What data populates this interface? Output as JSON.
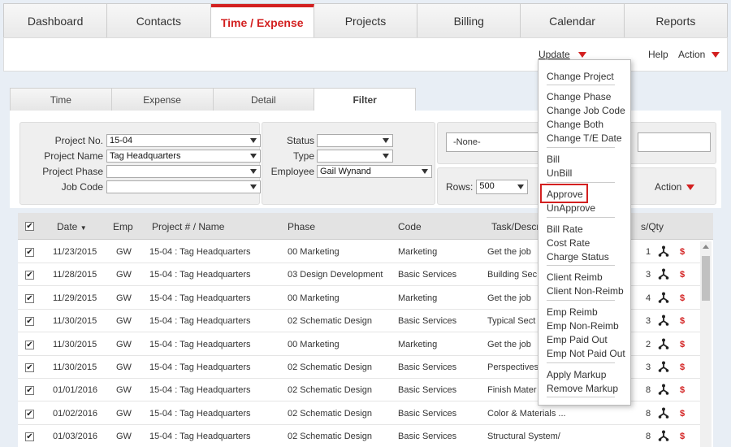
{
  "nav": {
    "tabs": [
      {
        "label": "Dashboard"
      },
      {
        "label": "Contacts"
      },
      {
        "label": "Time / Expense",
        "active": true
      },
      {
        "label": "Projects"
      },
      {
        "label": "Billing"
      },
      {
        "label": "Calendar"
      },
      {
        "label": "Reports"
      }
    ]
  },
  "header": {
    "update_label": "Update",
    "help_label": "Help",
    "action_label": "Action"
  },
  "subtabs": [
    {
      "label": "Time"
    },
    {
      "label": "Expense"
    },
    {
      "label": "Detail"
    },
    {
      "label": "Filter",
      "active": true
    }
  ],
  "filters": {
    "project_no": {
      "label": "Project No.",
      "value": "15-04"
    },
    "project_name": {
      "label": "Project Name",
      "value": "Tag Headquarters"
    },
    "project_phase": {
      "label": "Project Phase",
      "value": ""
    },
    "job_code": {
      "label": "Job Code",
      "value": ""
    },
    "status": {
      "label": "Status",
      "value": ""
    },
    "type": {
      "label": "Type",
      "value": ""
    },
    "employee": {
      "label": "Employee",
      "value": "Gail Wynand"
    },
    "none_select": {
      "value": "-None-"
    },
    "rows": {
      "label": "Rows:",
      "value": "500"
    },
    "action_label": "Action"
  },
  "table": {
    "headers": {
      "date": "Date",
      "emp": "Emp",
      "project": "Project # / Name",
      "phase": "Phase",
      "code": "Code",
      "task": "Task/Descr",
      "qty": "s/Qty"
    },
    "rows": [
      {
        "checked": "✔",
        "date": "11/23/2015",
        "emp": "GW",
        "project": "15-04 : Tag Headquarters",
        "phase": "00 Marketing",
        "code": "Marketing",
        "task": "Get the job",
        "qty": "1"
      },
      {
        "checked": "✔",
        "date": "11/28/2015",
        "emp": "GW",
        "project": "15-04 : Tag Headquarters",
        "phase": "03 Design Development",
        "code": "Basic Services",
        "task": "Building Sec",
        "qty": "3"
      },
      {
        "checked": "✔",
        "date": "11/29/2015",
        "emp": "GW",
        "project": "15-04 : Tag Headquarters",
        "phase": "00 Marketing",
        "code": "Marketing",
        "task": "Get the job",
        "qty": "4"
      },
      {
        "checked": "✔",
        "date": "11/30/2015",
        "emp": "GW",
        "project": "15-04 : Tag Headquarters",
        "phase": "02 Schematic Design",
        "code": "Basic Services",
        "task": "Typical Sect",
        "qty": "3"
      },
      {
        "checked": "✔",
        "date": "11/30/2015",
        "emp": "GW",
        "project": "15-04 : Tag Headquarters",
        "phase": "00 Marketing",
        "code": "Marketing",
        "task": "Get the job",
        "qty": "2"
      },
      {
        "checked": "✔",
        "date": "11/30/2015",
        "emp": "GW",
        "project": "15-04 : Tag Headquarters",
        "phase": "02 Schematic Design",
        "code": "Basic Services",
        "task": "Perspectives",
        "qty": "3"
      },
      {
        "checked": "✔",
        "date": "01/01/2016",
        "emp": "GW",
        "project": "15-04 : Tag Headquarters",
        "phase": "02 Schematic Design",
        "code": "Basic Services",
        "task": "Finish Mater",
        "qty": "8"
      },
      {
        "checked": "✔",
        "date": "01/02/2016",
        "emp": "GW",
        "project": "15-04 : Tag Headquarters",
        "phase": "02 Schematic Design",
        "code": "Basic Services",
        "task": "Color & Materials ...",
        "qty": "8"
      },
      {
        "checked": "✔",
        "date": "01/03/2016",
        "emp": "GW",
        "project": "15-04 : Tag Headquarters",
        "phase": "02 Schematic Design",
        "code": "Basic Services",
        "task": "Structural System/",
        "qty": "8"
      }
    ],
    "header_checked": "✔",
    "dollar": "$"
  },
  "menu": {
    "items": [
      {
        "label": "Change Project"
      },
      {
        "label": "Change Phase"
      },
      {
        "label": "Change Job Code"
      },
      {
        "label": "Change Both"
      },
      {
        "label": "Change T/E Date"
      },
      {
        "label": "Bill"
      },
      {
        "label": "UnBill"
      },
      {
        "label": "Approve",
        "highlighted": true
      },
      {
        "label": "UnApprove"
      },
      {
        "label": "Bill Rate"
      },
      {
        "label": "Cost Rate"
      },
      {
        "label": "Charge Status"
      },
      {
        "label": "Client Reimb"
      },
      {
        "label": "Client Non-Reimb"
      },
      {
        "label": "Emp Reimb"
      },
      {
        "label": "Emp Non-Reimb"
      },
      {
        "label": "Emp Paid Out"
      },
      {
        "label": "Emp Not Paid Out"
      },
      {
        "label": "Apply Markup"
      },
      {
        "label": "Remove Markup"
      }
    ]
  },
  "colors": {
    "accent": "#d32020"
  }
}
